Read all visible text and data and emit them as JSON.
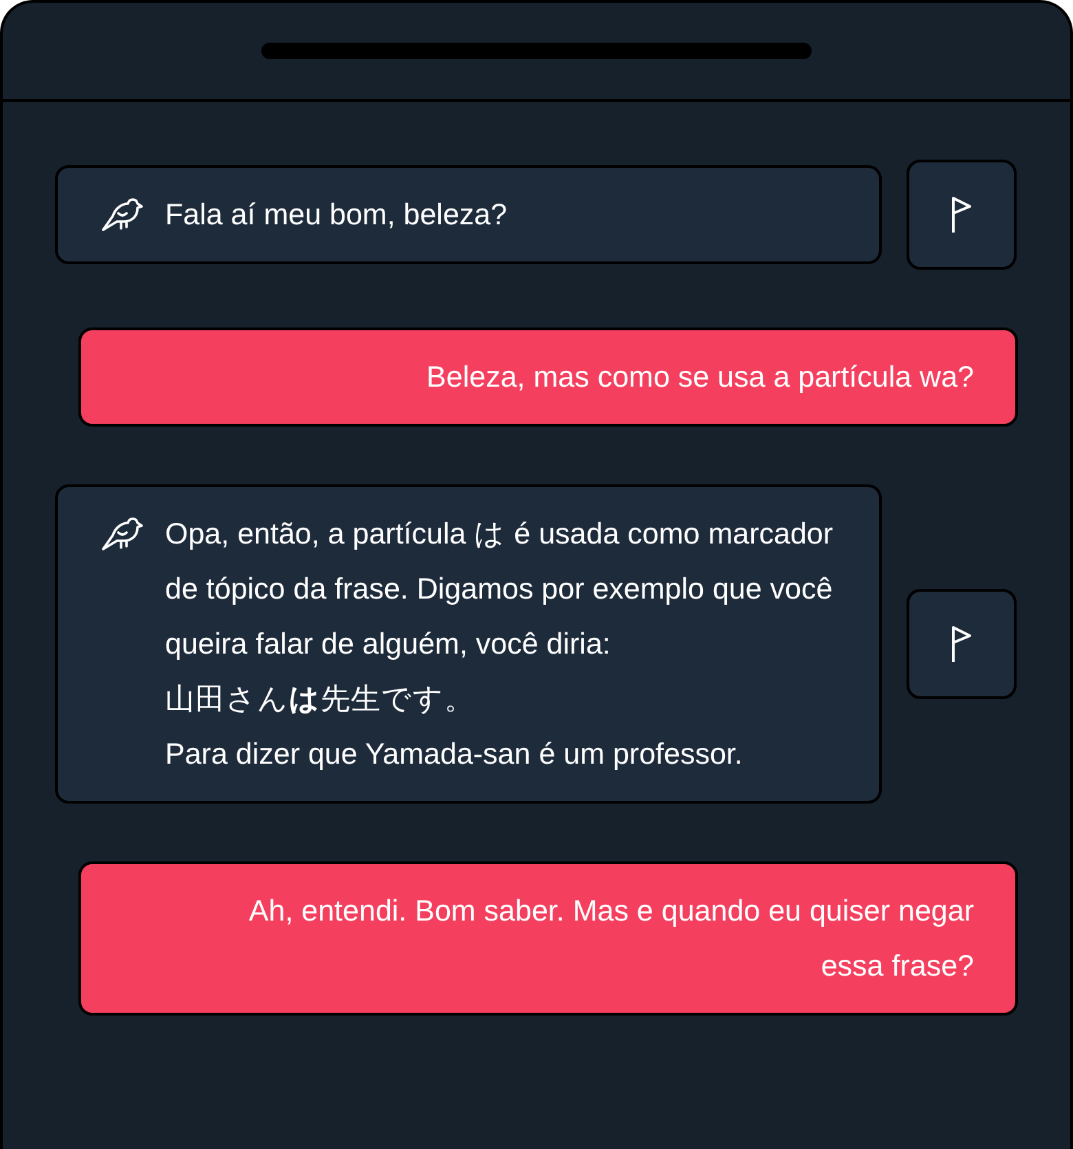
{
  "messages": [
    {
      "kind": "bot",
      "text": "Fala aí meu bom, beleza?"
    },
    {
      "kind": "user",
      "text": "Beleza, mas como se usa a partícula wa?"
    },
    {
      "kind": "bot",
      "text": "Opa, então, a partícula は é usada como marcador de tópico da frase. Digamos por exemplo que você queira falar de alguém, você diria:\n山田さん**は**先生です。\nPara dizer que Yamada-san é um professor."
    },
    {
      "kind": "user",
      "text": "Ah, entendi. Bom saber. Mas e quando eu quiser negar essa frase?"
    }
  ]
}
